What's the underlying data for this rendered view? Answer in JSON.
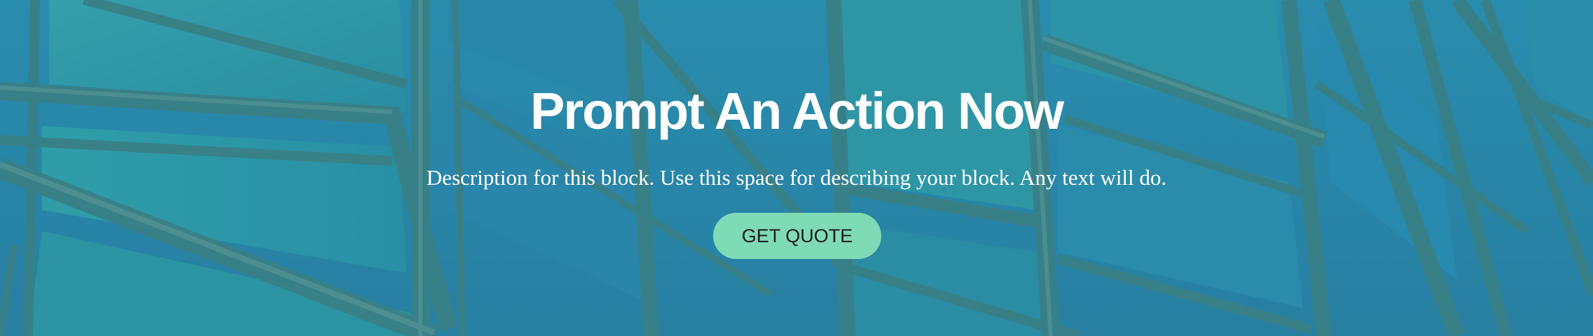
{
  "hero": {
    "title": "Prompt An Action Now",
    "description": "Description for this block. Use this space for describing your block. Any text will do.",
    "button_label": "GET QUOTE"
  },
  "colors": {
    "overlay": "#2586a3",
    "button_bg": "#7fdbb6",
    "button_text": "#1b1b1b",
    "text": "#ffffff"
  }
}
